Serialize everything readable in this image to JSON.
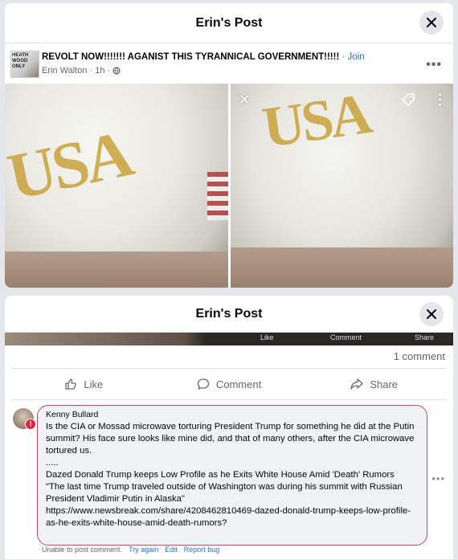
{
  "modal_top": {
    "title": "Erin's Post",
    "avatar_text": "HEATH WOOD ONLY",
    "group_name": "REVOLT NOW!!!!!!! AGANIST THIS TYRANNICAL GOVERNMENT!!!!!",
    "join_separator": " · ",
    "join_label": "Join",
    "author_time": "Erin Walton · 1h ·",
    "photo_left_text": "USA",
    "photo_right_text": "USA"
  },
  "modal_bottom": {
    "title": "Erin's Post",
    "strip_labels": [
      "Like",
      "Comment",
      "Share"
    ],
    "comment_count": "1 comment",
    "actions": {
      "like": "Like",
      "comment": "Comment",
      "share": "Share"
    },
    "comment": {
      "author": "Kenny Bullard",
      "text": "Is the CIA or Mossad microwave torturing President Trump for something he did at the Putin summit? His face sure looks like mine did, and that of many others, after the CIA microwave tortured us.\n.....\nDazed Donald Trump keeps Low Profile as he Exits White House Amid 'Death' Rumors\n\"The last time Trump traveled outside of Washington was during his summit with Russian President Vladimir Putin in Alaska\"\nhttps://www.newsbreak.com/share/4208462810469-dazed-donald-trump-keeps-low-profile-as-he-exits-white-house-amid-death-rumors?",
      "status_error": "Unable to post comment.",
      "try_again": "Try again",
      "edit": "Edit",
      "report": "Report bug"
    }
  },
  "colors": {
    "link": "#216fdb",
    "error_border": "#c8475d",
    "error_badge": "#e41e3f"
  }
}
